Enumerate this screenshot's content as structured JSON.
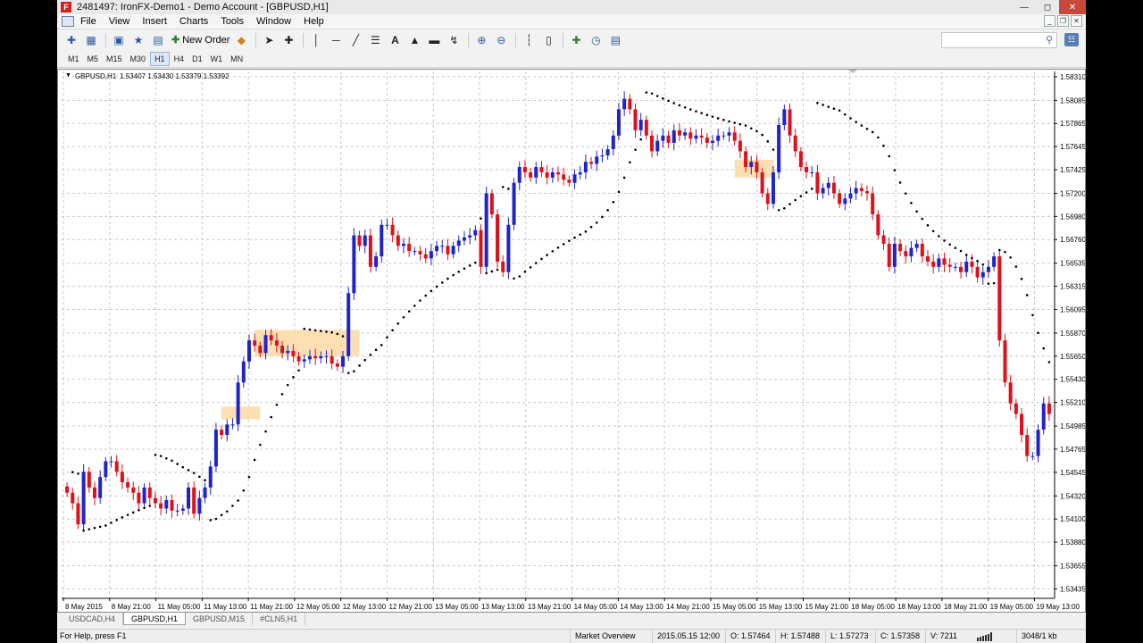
{
  "window": {
    "title": "2481497: IronFX-Demo1 - Demo Account - [GBPUSD,H1]",
    "logo_letter": "F"
  },
  "menu": [
    "File",
    "View",
    "Insert",
    "Charts",
    "Tools",
    "Window",
    "Help"
  ],
  "toolbar": {
    "new_order_label": "New Order",
    "icons": [
      "new-chart-icon",
      "profiles-icon",
      "market-watch-icon",
      "navigator-icon",
      "terminal-icon",
      "new-order-icon",
      "auto-trading-icon",
      "cursor-icon",
      "crosshair-icon",
      "vertical-line-icon",
      "horizontal-line-icon",
      "trendline-icon",
      "fibonacci-icon",
      "text-icon",
      "label-icon",
      "rectangle-icon",
      "arrows-icon",
      "zoom-in-icon",
      "zoom-out-icon",
      "bar-chart-icon",
      "candle-chart-icon",
      "indicators-icon",
      "periods-icon",
      "templates-icon"
    ]
  },
  "timeframes": {
    "items": [
      "M1",
      "M5",
      "M15",
      "M30",
      "H1",
      "H4",
      "D1",
      "W1",
      "MN"
    ],
    "active": "H1"
  },
  "chart": {
    "symbol_label": "GBPUSD,H1",
    "ohlc_label": "1.53407 1.53430 1.53379 1.53392"
  },
  "chart_data": {
    "type": "candlestick",
    "symbol": "GBPUSD",
    "timeframe": "H1",
    "ylim": [
      1.53345,
      1.5836
    ],
    "y_ticks": [
      "1.58310",
      "1.58085",
      "1.57865",
      "1.57645",
      "1.57425",
      "1.57200",
      "1.56980",
      "1.56760",
      "1.56535",
      "1.56315",
      "1.56095",
      "1.55870",
      "1.55650",
      "1.55430",
      "1.55210",
      "1.54985",
      "1.54765",
      "1.54545",
      "1.54320",
      "1.54100",
      "1.53880",
      "1.53655",
      "1.53435"
    ],
    "x_ticks": [
      "8 May 2015",
      "8 May 21:00",
      "11 May 05:00",
      "11 May 13:00",
      "11 May 21:00",
      "12 May 05:00",
      "12 May 13:00",
      "12 May 21:00",
      "13 May 05:00",
      "13 May 13:00",
      "13 May 21:00",
      "14 May 05:00",
      "14 May 13:00",
      "14 May 21:00",
      "15 May 05:00",
      "15 May 13:00",
      "15 May 21:00",
      "18 May 05:00",
      "18 May 13:00",
      "18 May 21:00",
      "19 May 05:00",
      "19 May 13:00"
    ],
    "bull_color": "#1f24c8",
    "bear_color": "#e0101a",
    "sar_color": "#000000",
    "highlight_color": "#fbd9a6",
    "grid": "dashed",
    "closes": [
      1.5435,
      1.5425,
      1.5405,
      1.5455,
      1.544,
      1.543,
      1.545,
      1.5465,
      1.5465,
      1.5455,
      1.5445,
      1.544,
      1.5435,
      1.5425,
      1.544,
      1.543,
      1.5425,
      1.542,
      1.5428,
      1.5418,
      1.5418,
      1.542,
      1.544,
      1.5415,
      1.543,
      1.544,
      1.546,
      1.5495,
      1.549,
      1.55,
      1.55,
      1.554,
      1.556,
      1.558,
      1.5575,
      1.5568,
      1.5585,
      1.558,
      1.5575,
      1.5568,
      1.557,
      1.5565,
      1.556,
      1.5562,
      1.5565,
      1.5563,
      1.5565,
      1.5565,
      1.5558,
      1.5555,
      1.5565,
      1.5625,
      1.568,
      1.567,
      1.568,
      1.565,
      1.566,
      1.569,
      1.569,
      1.568,
      1.567,
      1.5672,
      1.5665,
      1.5665,
      1.5662,
      1.5658,
      1.5665,
      1.567,
      1.567,
      1.5662,
      1.567,
      1.5675,
      1.5678,
      1.568,
      1.5685,
      1.565,
      1.572,
      1.57,
      1.5655,
      1.5645,
      1.569,
      1.573,
      1.5745,
      1.574,
      1.5735,
      1.5745,
      1.574,
      1.5735,
      1.574,
      1.5738,
      1.5733,
      1.573,
      1.5738,
      1.574,
      1.575,
      1.5748,
      1.5755,
      1.5756,
      1.5762,
      1.5775,
      1.58,
      1.581,
      1.58,
      1.578,
      1.579,
      1.5775,
      1.576,
      1.577,
      1.5775,
      1.5768,
      1.578,
      1.5775,
      1.5778,
      1.5772,
      1.5775,
      1.5773,
      1.5768,
      1.577,
      1.5775,
      1.5775,
      1.5778,
      1.577,
      1.576,
      1.5745,
      1.575,
      1.574,
      1.572,
      1.571,
      1.574,
      1.5785,
      1.58,
      1.5775,
      1.576,
      1.5745,
      1.574,
      1.574,
      1.572,
      1.5725,
      1.573,
      1.572,
      1.571,
      1.5715,
      1.572,
      1.5725,
      1.5722,
      1.572,
      1.57,
      1.568,
      1.5672,
      1.565,
      1.5672,
      1.5665,
      1.566,
      1.5668,
      1.5672,
      1.566,
      1.5655,
      1.565,
      1.5658,
      1.5652,
      1.565,
      1.565,
      1.5645,
      1.5655,
      1.565,
      1.564,
      1.5645,
      1.565,
      1.566,
      1.558,
      1.554,
      1.552,
      1.551,
      1.549,
      1.547,
      1.547,
      1.5495,
      1.552,
      1.551
    ]
  },
  "tabs": [
    "USDCAD,H4",
    "GBPUSD,H1",
    "GBPUSD,M15",
    "#CLN5,H1"
  ],
  "active_tab": "GBPUSD,H1",
  "status": {
    "help": "For Help, press F1",
    "profile": "Market Overview",
    "datetime": "2015.05.15 12:00",
    "open": "O: 1.57464",
    "high": "H: 1.57488",
    "low": "L: 1.57273",
    "close": "C: 1.57358",
    "volume": "V: 7211",
    "traffic": "3048/1 kb"
  }
}
